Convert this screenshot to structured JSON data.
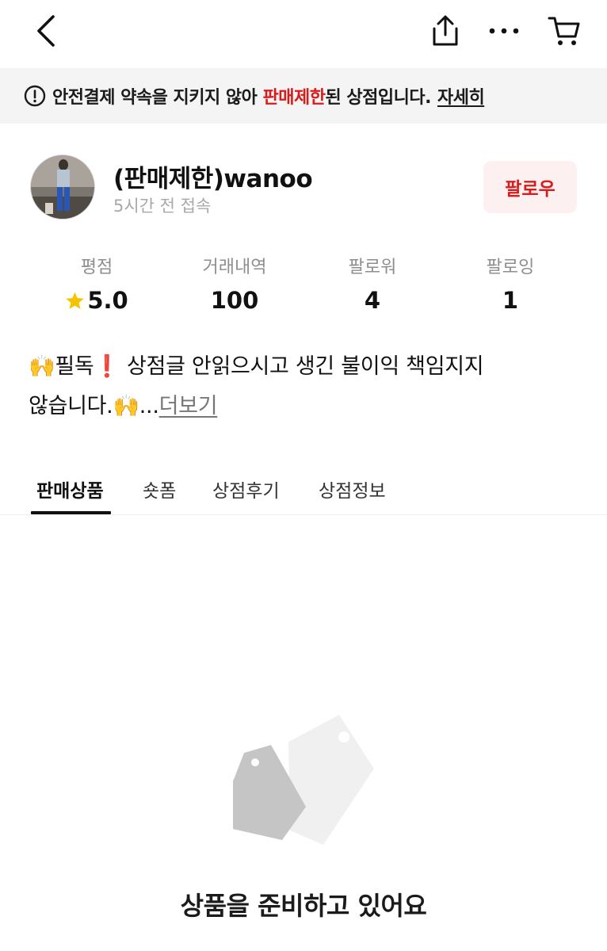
{
  "nav": {
    "back_icon": "chevron-left-icon",
    "share_icon": "share-icon",
    "more_icon": "more-horizontal-icon",
    "cart_icon": "cart-icon"
  },
  "banner": {
    "icon": "alert-circle-icon",
    "text_before": "안전결제 약속을 지키지 않아 ",
    "highlight": "판매제한",
    "text_after": "된 상점입니다.",
    "link": "자세히",
    "highlight_color": "#d81b1b"
  },
  "profile": {
    "name": "(판매제한)wanoo",
    "last_access": "5시간 전 접속",
    "follow_label": "팔로우"
  },
  "stats": [
    {
      "label": "평점",
      "value": "5.0",
      "icon": "star-icon"
    },
    {
      "label": "거래내역",
      "value": "100"
    },
    {
      "label": "팔로워",
      "value": "4"
    },
    {
      "label": "팔로잉",
      "value": "1"
    }
  ],
  "intro": {
    "line1": "🙌필독❗ 상점글 안읽으시고 생긴 불이익 책임지지",
    "line2": "않습니다.🙌...",
    "more_label": "더보기"
  },
  "tabs": [
    {
      "label": "판매상품",
      "active": true
    },
    {
      "label": "숏폼",
      "active": false
    },
    {
      "label": "상점후기",
      "active": false
    },
    {
      "label": "상점정보",
      "active": false
    }
  ],
  "empty_state": {
    "icon": "price-tags-icon",
    "message": "상품을 준비하고 있어요"
  },
  "colors": {
    "accent": "#d81b1b",
    "follow_bg": "#fdf0f0",
    "banner_bg": "#f4f4f4"
  }
}
